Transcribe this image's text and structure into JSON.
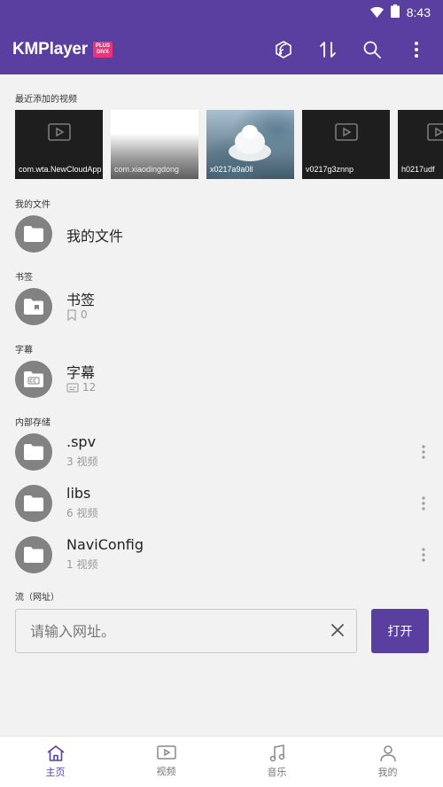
{
  "status_bar": {
    "time": "8:43"
  },
  "app_bar": {
    "brand": "KMPlayer",
    "badge_line1": "PLUS",
    "badge_line2": "DIVX",
    "actions": [
      "cast-icon",
      "sort-icon",
      "search-icon",
      "more-vert-icon"
    ]
  },
  "recent": {
    "label": "最近添加的视频",
    "items": [
      {
        "caption": "com.wta.NewCloudApp",
        "style": "dark"
      },
      {
        "caption": "com.xiaodingdong",
        "style": "white"
      },
      {
        "caption": "x0217a9a0ll",
        "style": "photo"
      },
      {
        "caption": "v0217g3znnp",
        "style": "dark"
      },
      {
        "caption": "h0217udf",
        "style": "dark"
      }
    ]
  },
  "my_files": {
    "label": "我的文件",
    "title": "我的文件"
  },
  "bookmarks": {
    "label": "书签",
    "title": "书签",
    "count": "0"
  },
  "subtitles": {
    "label": "字幕",
    "title": "字幕",
    "count": "12"
  },
  "storage": {
    "label": "内部存储",
    "items": [
      {
        "name": ".spv",
        "count": "3 视频"
      },
      {
        "name": "libs",
        "count": "6 视频"
      },
      {
        "name": "NaviConfig",
        "count": "1 视频"
      }
    ]
  },
  "stream": {
    "label": "流（网址）",
    "placeholder": "请输入网址。",
    "open_label": "打开"
  },
  "bottom_nav": {
    "items": [
      {
        "label": "主页",
        "icon": "home-icon",
        "active": true
      },
      {
        "label": "视频",
        "icon": "video-icon",
        "active": false
      },
      {
        "label": "音乐",
        "icon": "music-icon",
        "active": false
      },
      {
        "label": "我的",
        "icon": "person-icon",
        "active": false
      }
    ]
  },
  "colors": {
    "primary": "#5a3fa0",
    "badge": "#e8347a",
    "folder_icon": "#828282"
  }
}
